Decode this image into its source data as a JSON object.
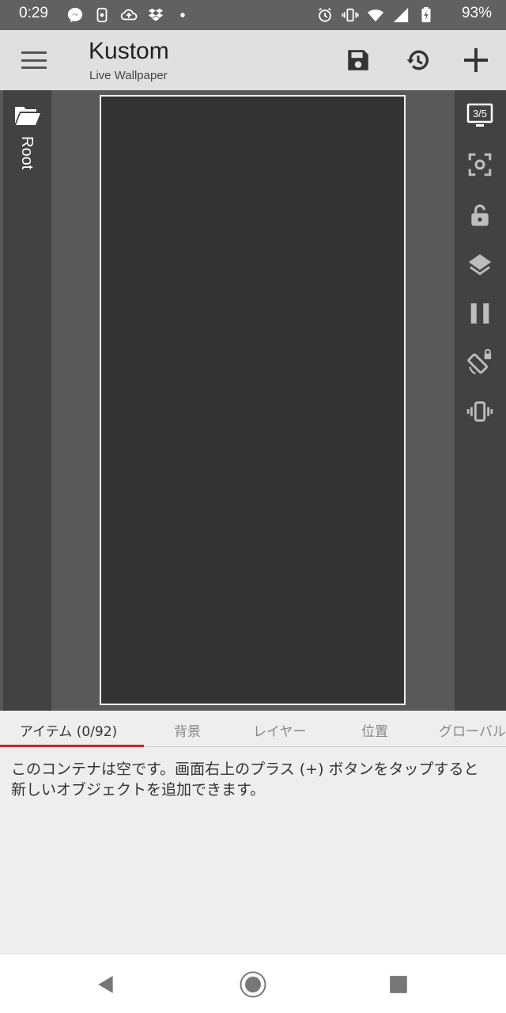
{
  "status_bar": {
    "time": "0:29",
    "battery": "93%",
    "left_icons": [
      "messenger-icon",
      "notification-icon",
      "cloud-upload-icon",
      "dropbox-icon",
      "dot-icon"
    ],
    "right_icons": [
      "alarm-icon",
      "vibrate-icon",
      "wifi-icon",
      "signal-icon",
      "battery-charging-icon"
    ]
  },
  "app_bar": {
    "title": "Kustom",
    "subtitle": "Live Wallpaper",
    "actions": [
      "save-icon",
      "history-icon",
      "add-icon"
    ]
  },
  "left_rail": {
    "root_label": "Root"
  },
  "right_rail": {
    "preview_badge": "3/5",
    "tools": [
      "preview-screen-icon",
      "focus-icon",
      "lock-open-icon",
      "layers-icon",
      "pause-icon",
      "screen-rotation-lock-icon",
      "vibration-icon"
    ]
  },
  "tabs": [
    {
      "label": "アイテム (0/92)",
      "active": true
    },
    {
      "label": "背景",
      "active": false
    },
    {
      "label": "レイヤー",
      "active": false
    },
    {
      "label": "位置",
      "active": false
    },
    {
      "label": "グローバル",
      "active": false
    }
  ],
  "content": {
    "empty_message": "このコンテナは空です。画面右上のプラス (+) ボタンをタップすると新しいオブジェクトを追加できます。"
  },
  "colors": {
    "accent": "#c62828",
    "status_bar": "#616161",
    "app_bar": "#e0e0e0",
    "rail": "#424242",
    "canvas": "#333333"
  }
}
